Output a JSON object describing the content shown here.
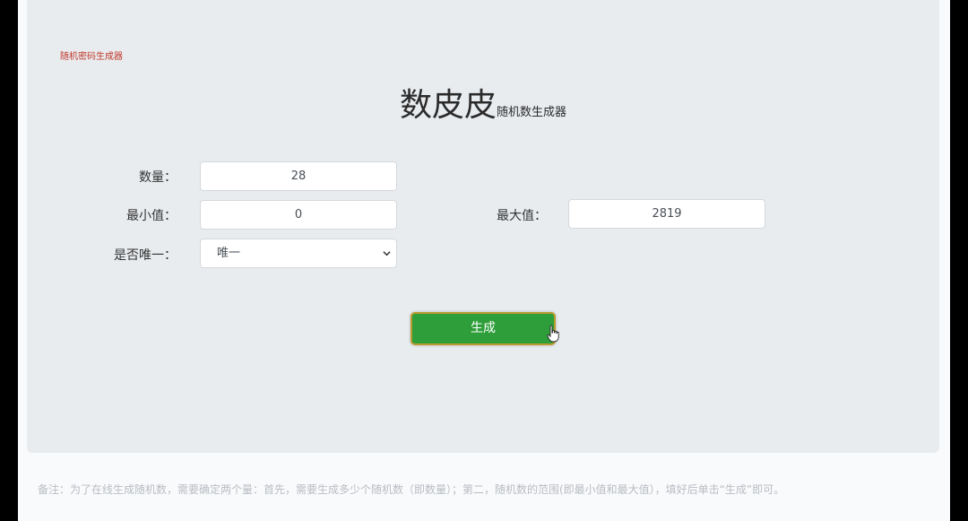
{
  "header": {
    "site_link": "随机密码生成器",
    "title_main": "数皮皮",
    "title_sub": "随机数生成器"
  },
  "form": {
    "count_label": "数量：",
    "count_value": "28",
    "min_label": "最小值：",
    "min_value": "0",
    "max_label": "最大值：",
    "max_value": "2819",
    "unique_label": "是否唯一：",
    "unique_selected": "唯一"
  },
  "actions": {
    "generate_label": "生成"
  },
  "note": {
    "text": "备注：为了在线生成随机数，需要确定两个量：首先，需要生成多少个随机数（即数量）；第二，随机数的范围(即最小值和最大值），填好后单击“生成”即可。"
  },
  "colors": {
    "button_green": "#2e9e3a",
    "button_border": "#b89a2e",
    "panel_bg": "#e9ecef",
    "link_red": "#c0392b"
  },
  "icons": {
    "select_chevron": "chevron-down-icon",
    "pointer": "hand-pointer-icon"
  }
}
